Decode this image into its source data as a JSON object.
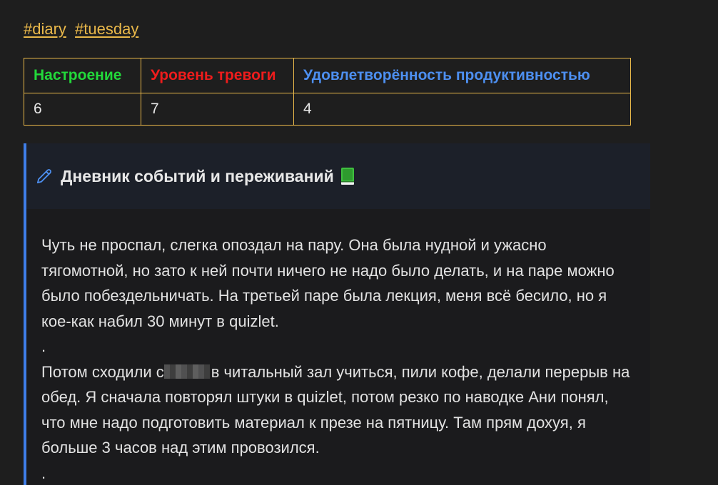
{
  "tags": [
    "#diary",
    "#tuesday"
  ],
  "metrics": {
    "headers": [
      {
        "label": "Настроение",
        "color": "#22d93a"
      },
      {
        "label": "Уровень тревоги",
        "color": "#ee1c1c"
      },
      {
        "label": "Удовлетворённость продуктивностью",
        "color": "#4d8ff0"
      }
    ],
    "values": [
      "6",
      "7",
      "4"
    ]
  },
  "callout": {
    "title": "Дневник событий и переживаний",
    "accent_color": "#3f7ee8",
    "icon": "pencil-icon",
    "title_emoji": "book-icon",
    "paragraphs": [
      "Чуть не проспал, слегка опоздал на пару. Она была нудной и ужасно тягомотной, но зато к ней почти ничего не надо было делать, и на паре можно было побездельничать. На третьей паре была лекция, меня всё бесило, но я кое-как набил 30 минут в quizlet.",
      ".",
      "перерыв на обед. Я сначала повторял штуки в quizlet, потом резко по наводке Ани понял, что мне надо подготовить материал к презе на пятницу. Там прям дохуя, я больше 3 часов над этим провозился.",
      "."
    ],
    "p3_start": "Потом сходили с",
    "p3_after_blur": "в читальный зал учиться, пили кофе, делали"
  }
}
